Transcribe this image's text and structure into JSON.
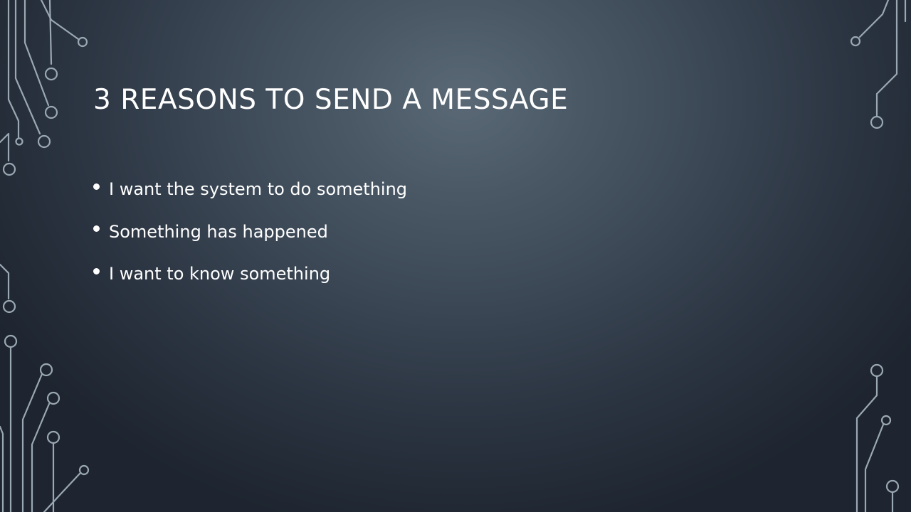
{
  "slide": {
    "title": "3 REASONS TO SEND A MESSAGE",
    "bullets": [
      "I want the system to do something",
      "Something has happened",
      "I want to know something"
    ]
  },
  "colors": {
    "background_center": "#5a6975",
    "background_edge": "#1e2530",
    "circuit_line": "#9aa8b3",
    "text": "#ffffff"
  },
  "decorations": {
    "left": "circuit-board-icon",
    "right": "circuit-board-icon"
  }
}
